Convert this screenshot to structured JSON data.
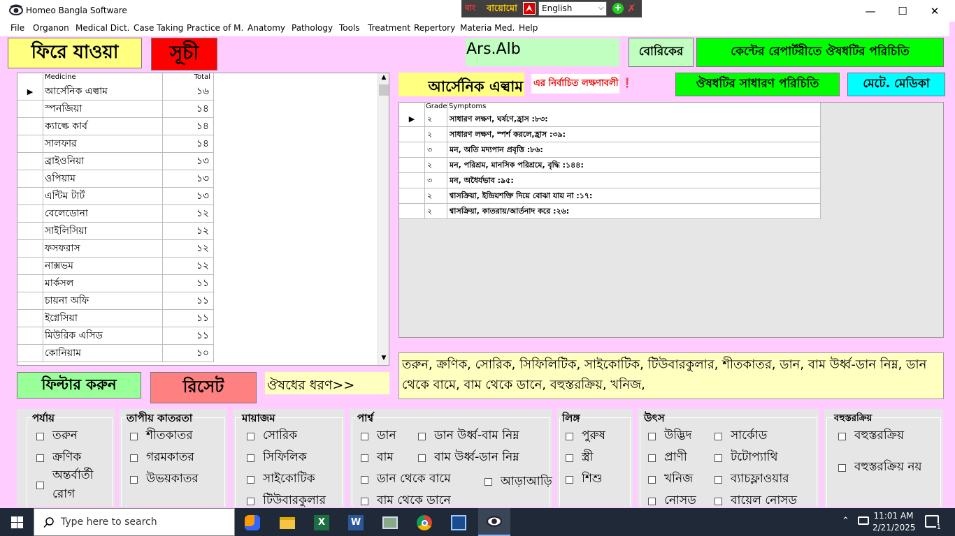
{
  "window": {
    "title": "Homeo Bangla Software"
  },
  "title_strip": {
    "label": "বায়োমো",
    "language": "English"
  },
  "menu": [
    "File",
    "Organon",
    "Medical Dict.",
    "Case Taking",
    "Practice of M.",
    "Anatomy",
    "Pathology",
    "Tools",
    "Treatment",
    "Repertory",
    "Materia Med.",
    "Help"
  ],
  "buttons": {
    "back": "ফিরে যাওয়া",
    "index": "সূচী",
    "boericke": "বোরিকের",
    "kent": "কেন্টের রেপার্টরীতে ঔষধটির পরিচিতি",
    "general_intro": "ঔষধটির সাধারণ পরিচিতি",
    "materia_medica": "মেটে. মেডিকা",
    "filter": "ফিল্টার করুন",
    "reset": "রিসেট"
  },
  "selected_abbr": "Ars.Alb",
  "selected_name": "আর্সেনিক এল্বাম",
  "selected_symptoms_note": "এর নির্বাচিত লক্ষণাবলী",
  "medicine_label": "ঔষধের ধরণ>>",
  "medicine_grid": {
    "headers": [
      "Medicine",
      "Total"
    ],
    "rows": [
      {
        "name": "আর্সেনিক এল্বাম",
        "total": "১৬"
      },
      {
        "name": "স্পনজিয়া",
        "total": "১৪"
      },
      {
        "name": "ক্যাল্কে কার্ব",
        "total": "১৪"
      },
      {
        "name": "সালফার",
        "total": "১৪"
      },
      {
        "name": "ব্রাইওনিয়া",
        "total": "১৩"
      },
      {
        "name": "ওপিয়াম",
        "total": "১৩"
      },
      {
        "name": "এন্টিম টার্ট",
        "total": "১৩"
      },
      {
        "name": "বেলেডোনা",
        "total": "১২"
      },
      {
        "name": "সাইলিসিয়া",
        "total": "১২"
      },
      {
        "name": "ফসফরাস",
        "total": "১২"
      },
      {
        "name": "নাক্সভম",
        "total": "১২"
      },
      {
        "name": "মার্কসল",
        "total": "১১"
      },
      {
        "name": "চায়না অফি",
        "total": "১১"
      },
      {
        "name": "ইগ্নেসিয়া",
        "total": "১১"
      },
      {
        "name": "মিউরিক এসিড",
        "total": "১১"
      },
      {
        "name": "কোনিয়াম",
        "total": "১০"
      }
    ]
  },
  "symptom_grid": {
    "headers": [
      "Grade",
      "Symptoms"
    ],
    "rows": [
      {
        "grade": "২",
        "symptom": "সাধারণ লক্ষণ, ঘর্ষণে,হ্রাস :৮৩:"
      },
      {
        "grade": "২",
        "symptom": "সাধারণ লক্ষণ, স্পর্শ করলে,হ্রাস :৩৯:"
      },
      {
        "grade": "৩",
        "symptom": "মন, অতি মদ্যপান প্রবৃত্তি :৮৬:"
      },
      {
        "grade": "২",
        "symptom": "মন, পরিশ্রম, মানসিক পরিশ্রমে, বৃদ্ধি :১৪৪:"
      },
      {
        "grade": "৩",
        "symptom": "মন, অধৈর্যভাব :৯৫:"
      },
      {
        "grade": "২",
        "symptom": "শ্বাসক্রিয়া, ইন্দ্রিয়শক্তি দিয়ে বোঝা যায় না :১৭:"
      },
      {
        "grade": "২",
        "symptom": "শ্বাসক্রিয়া, কাতরায়/আর্তনাদ করে :২৬:"
      }
    ]
  },
  "types_text": "তরুন, ক্রণিক, সোরিক, সিফিলিটিক, সাইকোটিক, টিউবারকুলার, শীতকাতর, ডান, বাম উর্ধ্ব-ডান নিম্ন, ডান থেকে বামে, বাম থেকে ডানে, বহুস্তরক্রিয়, খনিজ,",
  "filter_groups": {
    "paryay": {
      "title": "পর্যায়",
      "items": [
        "তরুন",
        "ক্রণিক",
        "অন্তর্বার্তী রোগ"
      ]
    },
    "tapiya": {
      "title": "তাপীয় কাতরতা",
      "items": [
        "শীতকাতর",
        "গরমকাতর",
        "উভয়কাতর"
      ]
    },
    "miasm": {
      "title": "মায়াজম",
      "items": [
        "সোরিক",
        "সিফিলিক",
        "সাইকোটিক",
        "টিউবারকুলার"
      ]
    },
    "side": {
      "title": "পার্শ্ব",
      "items": [
        "ডান",
        "বাম",
        "ডান থেকে বামে",
        "বাম থেকে ডানে",
        "ডান উর্ধ্ব-বাম নিম্ন",
        "বাম উর্ধ্ব-ডান নিম্ন",
        "আড়াআড়ি"
      ]
    },
    "gender": {
      "title": "লিঙ্গ",
      "items": [
        "পুরুষ",
        "স্ত্রী",
        "শিশু"
      ]
    },
    "source": {
      "title": "উৎস",
      "items": [
        "উদ্ভিদ",
        "প্রাণী",
        "খনিজ",
        "নোসড",
        "সার্কোড",
        "টটোপ্যাথি",
        "ব্যাচফ্লাওয়ার",
        "বায়েল নোসড"
      ]
    },
    "poly": {
      "title": "বহুস্তরক্রিয়",
      "items": [
        "বহুস্তরক্রিয়",
        "বহুস্তরক্রিয় নয়"
      ]
    }
  },
  "taskbar": {
    "search_placeholder": "Type here to search",
    "time": "11:01 AM",
    "date": "2/21/2025",
    "notifications": "1"
  },
  "colors": {
    "window_bg": "#ffccff",
    "yellow": "#ffff80",
    "green": "#00ff00",
    "red": "#ff0000",
    "cyan": "#00ffff",
    "light_green": "#99ff99",
    "pink": "#ff8080",
    "pale_yellow": "#ffffc0",
    "ars_field": "#c0ffc0"
  }
}
